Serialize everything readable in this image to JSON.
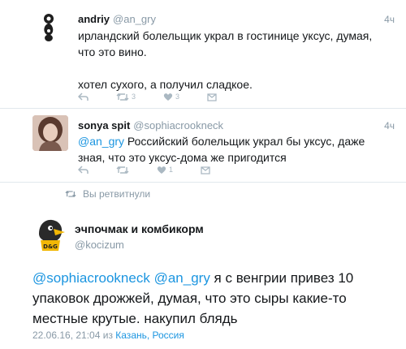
{
  "tweet1": {
    "name": "andriy",
    "handle": "@an_gry",
    "time": "4ч",
    "line1": "ирландский болельщик украл в гостинице уксус, думая,",
    "line2": "что это вино.",
    "line3": "хотел сухого, а получил сладкое.",
    "retweets": "3",
    "likes": "3"
  },
  "tweet2": {
    "name": "sonya spit",
    "handle": "@sophiacrookneck",
    "time": "4ч",
    "mention": "@an_gry",
    "line1_rest": " Российский болельщик украл бы уксус, даже",
    "line2": "зная, что это уксус-дома же пригодится",
    "likes": "1"
  },
  "retweeted_label": "Вы ретвитнули",
  "main": {
    "name": "эчпочмак и комбикорм",
    "handle": "@kocizum",
    "mention1": "@sophiacrookneck",
    "mention2": "@an_gry",
    "line1_rest": " я с венгрии привез 10",
    "line2": "упаковок дрожжей, думая, что это сыры какие-то",
    "line3": "местные крутые. накупил блядь",
    "timestamp": "22.06.16, 21:04 из ",
    "location": "Казань, Россия",
    "avatar_badge": "D&G"
  },
  "colors": {
    "link": "#1b95e0",
    "muted": "#8899a6",
    "icon": "#aab8c2"
  },
  "icons": [
    "reply-icon",
    "retweet-icon",
    "like-icon",
    "share-icon"
  ]
}
